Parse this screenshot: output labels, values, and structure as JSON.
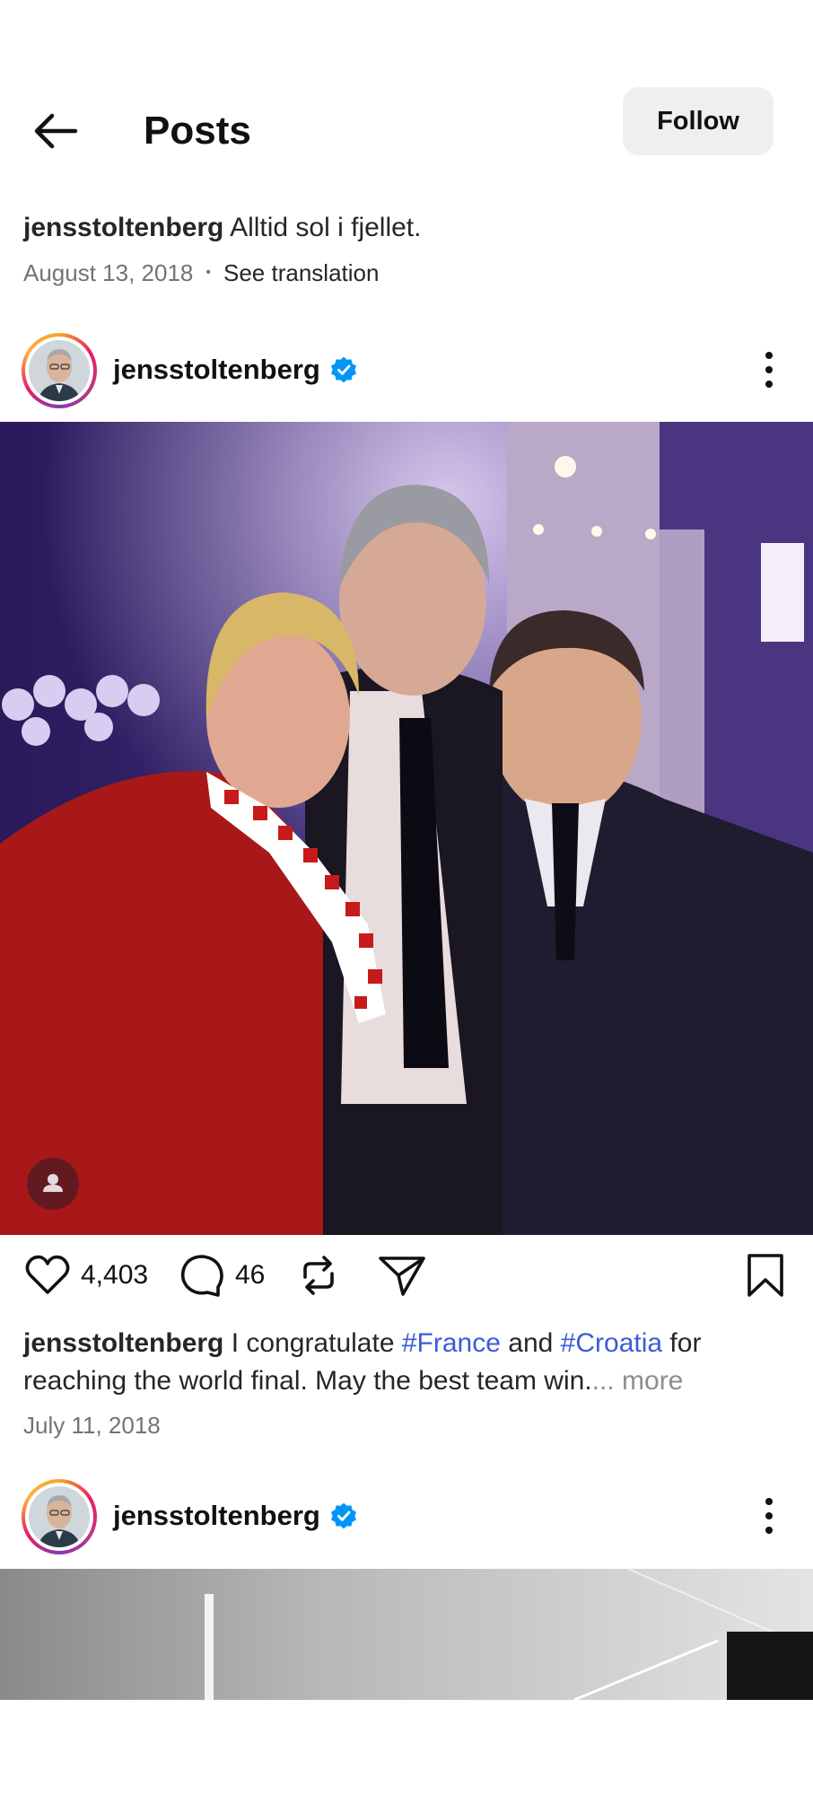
{
  "header": {
    "title": "Posts",
    "follow_label": "Follow"
  },
  "previous_post": {
    "username": "jensstoltenberg",
    "caption": "Alltid sol i fjellet.",
    "date": "August 13, 2018",
    "separator": "•",
    "translate_label": "See translation"
  },
  "post": {
    "username": "jensstoltenberg",
    "verified": true,
    "likes": "4,403",
    "comments": "46",
    "caption_user": "jensstoltenberg",
    "caption_parts": {
      "p1": "I congratulate",
      "tag1": "#France",
      "p2": "and",
      "tag2": "#Croatia",
      "p3": "for reaching the world final. May the best team win.",
      "ellipsis": "...",
      "more": "more"
    },
    "date": "July 11, 2018"
  },
  "next_post": {
    "username": "jensstoltenberg",
    "verified": true
  },
  "icons": [
    "back-arrow-icon",
    "verified-badge-icon",
    "more-options-icon",
    "heart-icon",
    "comment-icon",
    "repost-icon",
    "share-icon",
    "bookmark-icon",
    "person-tag-icon"
  ],
  "colors": {
    "verified": "#0095f6",
    "hashtag": "#3b5bdb",
    "follow_bg": "#efeff2",
    "meta_text": "#737373"
  }
}
